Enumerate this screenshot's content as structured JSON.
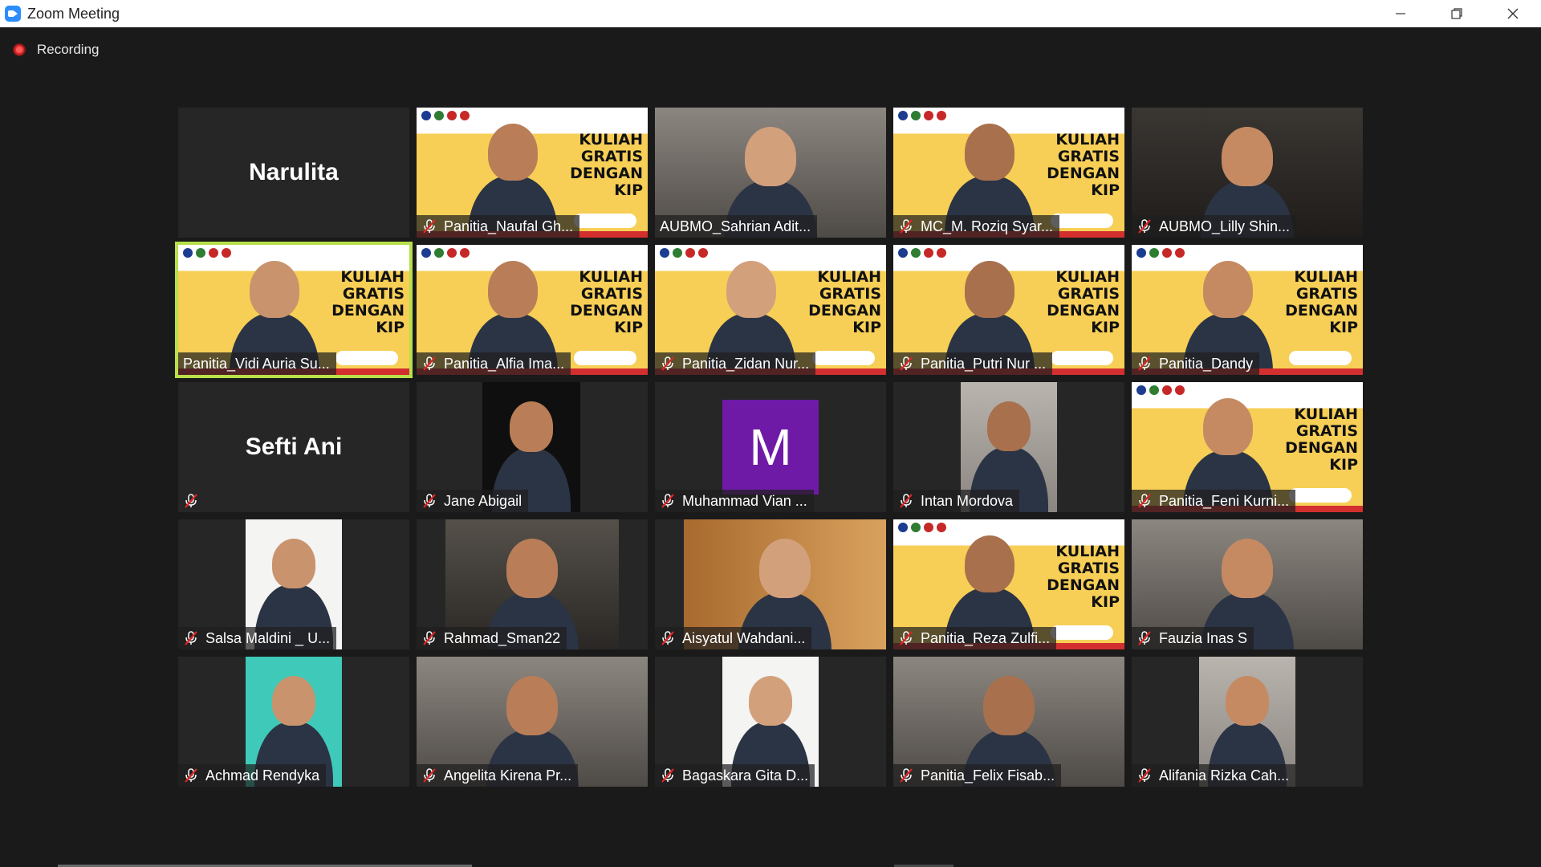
{
  "window": {
    "title": "Zoom Meeting"
  },
  "recording": {
    "label": "Recording"
  },
  "participants": [
    {
      "name": "Narulita",
      "style": "name"
    },
    {
      "name": "Panitia_Naufal Gh...",
      "style": "banner",
      "muted": true
    },
    {
      "name": "AUBMO_Sahrian Adit...",
      "style": "room"
    },
    {
      "name": "MC_M. Roziq Syar...",
      "style": "banner",
      "muted": true
    },
    {
      "name": "AUBMO_Lilly Shin...",
      "style": "dark",
      "muted": true
    },
    {
      "name": "Panitia_Vidi Auria Su...",
      "style": "banner",
      "active": true
    },
    {
      "name": "Panitia_Alfia Ima...",
      "style": "banner",
      "muted": true
    },
    {
      "name": "Panitia_Zidan Nur...",
      "style": "banner",
      "muted": true
    },
    {
      "name": "Panitia_Putri Nur ...",
      "style": "banner",
      "muted": true
    },
    {
      "name": "Panitia_Dandy",
      "style": "banner",
      "muted": true
    },
    {
      "name": "Sefti Ani",
      "style": "name",
      "muted": true
    },
    {
      "name": "Jane Abigail",
      "style": "darkcrop",
      "muted": true
    },
    {
      "name": "Muhammad Vian ...",
      "style": "avatar",
      "avatar_letter": "M",
      "muted": true
    },
    {
      "name": "Intan Mordova",
      "style": "crop",
      "muted": true
    },
    {
      "name": "Panitia_Feni Kurni...",
      "style": "banner",
      "muted": true
    },
    {
      "name": "Salsa Maldini _ U...",
      "style": "crop-white",
      "muted": true
    },
    {
      "name": "Rahmad_Sman22",
      "style": "darkwide",
      "muted": true
    },
    {
      "name": "Aisyatul Wahdani...",
      "style": "door",
      "muted": true
    },
    {
      "name": "Panitia_Reza Zulfi...",
      "style": "banner",
      "muted": true
    },
    {
      "name": "Fauzia Inas S",
      "style": "room",
      "muted": true
    },
    {
      "name": "Achmad Rendyka",
      "style": "crop-teal",
      "muted": true
    },
    {
      "name": "Angelita Kirena Pr...",
      "style": "room",
      "muted": true
    },
    {
      "name": "Bagaskara Gita D...",
      "style": "crop-white",
      "muted": true
    },
    {
      "name": "Panitia_Felix Fisab...",
      "style": "room",
      "muted": true
    },
    {
      "name": "Alifania Rizka Cah...",
      "style": "crop",
      "muted": true
    }
  ],
  "banner": {
    "lines": [
      "KULIAH",
      "GRATIS",
      "DENGAN",
      "KIP"
    ]
  },
  "colors": {
    "active_speaker": "#b7e04a",
    "muted_icon": "#e02424",
    "avatar_bg": "#6f1aa6"
  }
}
